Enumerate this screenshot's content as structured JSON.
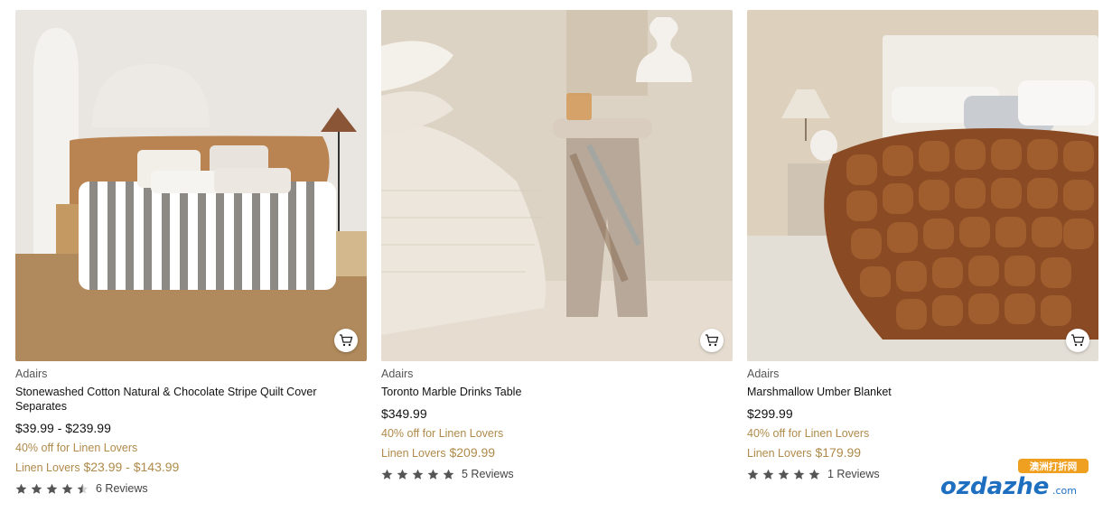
{
  "products": [
    {
      "brand": "Adairs",
      "title_line1": "Stonewashed Cotton Natural & Chocolate Stripe Quilt Cover",
      "title_line2": "Separates",
      "price": "$39.99 - $239.99",
      "promo": "40% off for Linen Lovers",
      "member_label": "Linen Lovers",
      "member_price": "$23.99 - $143.99",
      "rating": 4.5,
      "reviews": "6 Reviews"
    },
    {
      "brand": "Adairs",
      "title_line1": "Toronto Marble Drinks Table",
      "price": "$349.99",
      "promo": "40% off for Linen Lovers",
      "member_label": "Linen Lovers",
      "member_price": "$209.99",
      "rating": 5,
      "reviews": "5 Reviews"
    },
    {
      "brand": "Adairs",
      "title_line1": "Marshmallow Umber Blanket",
      "price": "$299.99",
      "promo": "40% off for Linen Lovers",
      "member_label": "Linen Lovers",
      "member_price": "$179.99",
      "rating": 5,
      "reviews": "1 Reviews"
    }
  ],
  "icons": {
    "cart": "cart-icon",
    "star": "star-icon"
  },
  "colors": {
    "promo": "#b08a4a",
    "star": "#555555"
  },
  "watermark": {
    "top": "澳洲打折网",
    "main": "ozdazhe",
    "suffix": ".com"
  }
}
